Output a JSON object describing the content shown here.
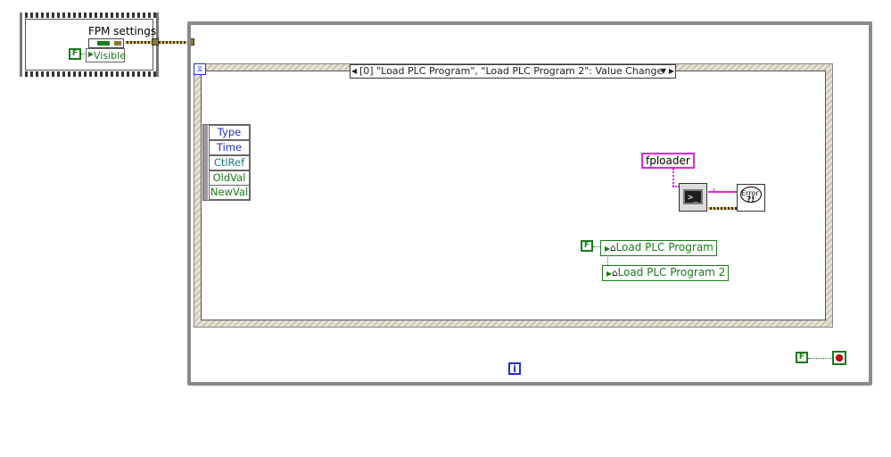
{
  "fpm_frame": {
    "title": "FPM settings",
    "property": "Visible",
    "bool_value": "F"
  },
  "event_structure": {
    "selector_label": "[0] \"Load PLC Program\", \"Load PLC Program 2\": Value Change",
    "event_data_items": [
      "Type",
      "Time",
      "CtlRef",
      "OldVal",
      "NewVal"
    ],
    "string_constant": "fploader",
    "bool_value": "F",
    "local_var_1": "Load PLC Program",
    "local_var_2": "Load PLC Program 2",
    "error_label": "Error"
  },
  "loop": {
    "iteration_label": "i",
    "stop_bool_value": "F"
  },
  "colors": {
    "boolean": "#1b7a1b",
    "string": "#e026e0",
    "cluster": "#8c7a32",
    "integer": "#1c2fd4",
    "structure_gray": "#8a8a8a"
  }
}
